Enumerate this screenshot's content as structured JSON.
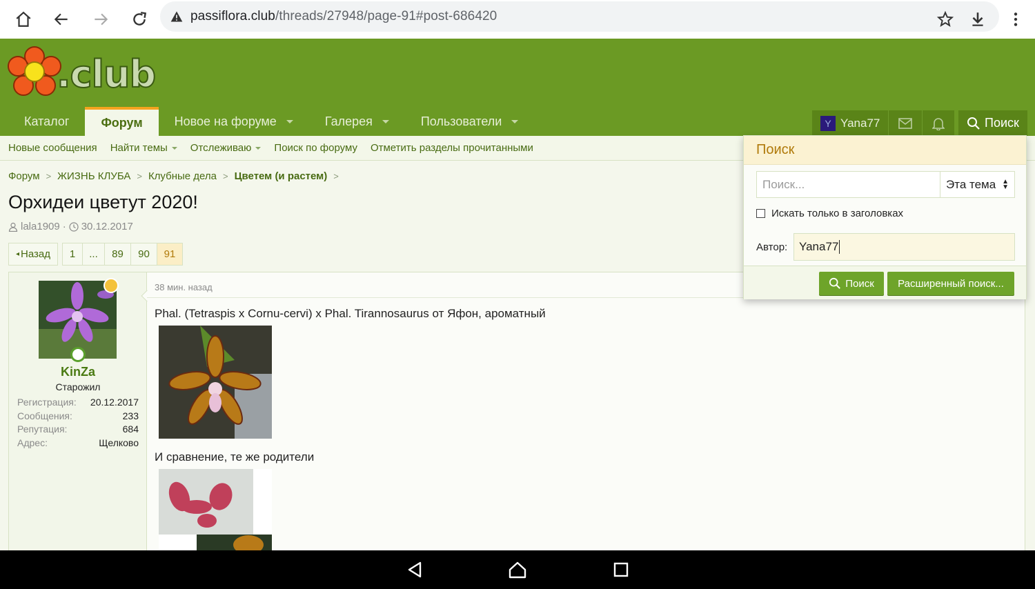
{
  "browser": {
    "url_host": "passiflora.club",
    "url_path": "/threads/27948/page-91#post-686420"
  },
  "header": {
    "logo_text": ".club",
    "nav": [
      {
        "label": "Каталог",
        "active": false,
        "dropdown": false
      },
      {
        "label": "Форум",
        "active": true,
        "dropdown": false
      },
      {
        "label": "Новое на форуме",
        "active": false,
        "dropdown": true
      },
      {
        "label": "Галерея",
        "active": false,
        "dropdown": true
      },
      {
        "label": "Пользователи",
        "active": false,
        "dropdown": true
      }
    ],
    "user_initial": "Y",
    "username": "Yana77",
    "search_label": "Поиск"
  },
  "subnav": [
    {
      "label": "Новые сообщения",
      "dropdown": false
    },
    {
      "label": "Найти темы",
      "dropdown": true
    },
    {
      "label": "Отслеживаю",
      "dropdown": true
    },
    {
      "label": "Поиск по форуму",
      "dropdown": false
    },
    {
      "label": "Отметить разделы прочитанными",
      "dropdown": false
    }
  ],
  "breadcrumb": [
    "Форум",
    "ЖИЗНЬ КЛУБА",
    "Клубные дела",
    "Цветем (и растем)"
  ],
  "thread": {
    "title": "Орхидеи цветут 2020!",
    "author": "lala1909",
    "date": "30.12.2017"
  },
  "pager": {
    "prev": "Назад",
    "pages": [
      "1",
      "...",
      "89",
      "90",
      "91"
    ],
    "current": "91"
  },
  "post": {
    "time": "38 мин. назад",
    "user": {
      "name": "KinZa",
      "title": "Старожил",
      "stats": [
        {
          "k": "Регистрация:",
          "v": "20.12.2017"
        },
        {
          "k": "Сообщения:",
          "v": "233"
        },
        {
          "k": "Репутация:",
          "v": "684"
        },
        {
          "k": "Адрес:",
          "v": "Щелково"
        }
      ]
    },
    "text1": "Phal. (Tetraspis x Cornu-cervi) x Phal. Tirannosaurus от Яфон, ароматный",
    "text2": "И сравнение, те же родители"
  },
  "search_menu": {
    "title": "Поиск",
    "placeholder": "Поиск...",
    "scope": "Эта тема",
    "titles_only": "Искать только в заголовках",
    "author_label": "Автор:",
    "author_value": "Yana77",
    "search_button": "Поиск",
    "advanced_button": "Расширенный поиск..."
  },
  "colors": {
    "header_green": "#6b9a24",
    "accent_orange": "#f4a41f",
    "link_green": "#486b12"
  }
}
